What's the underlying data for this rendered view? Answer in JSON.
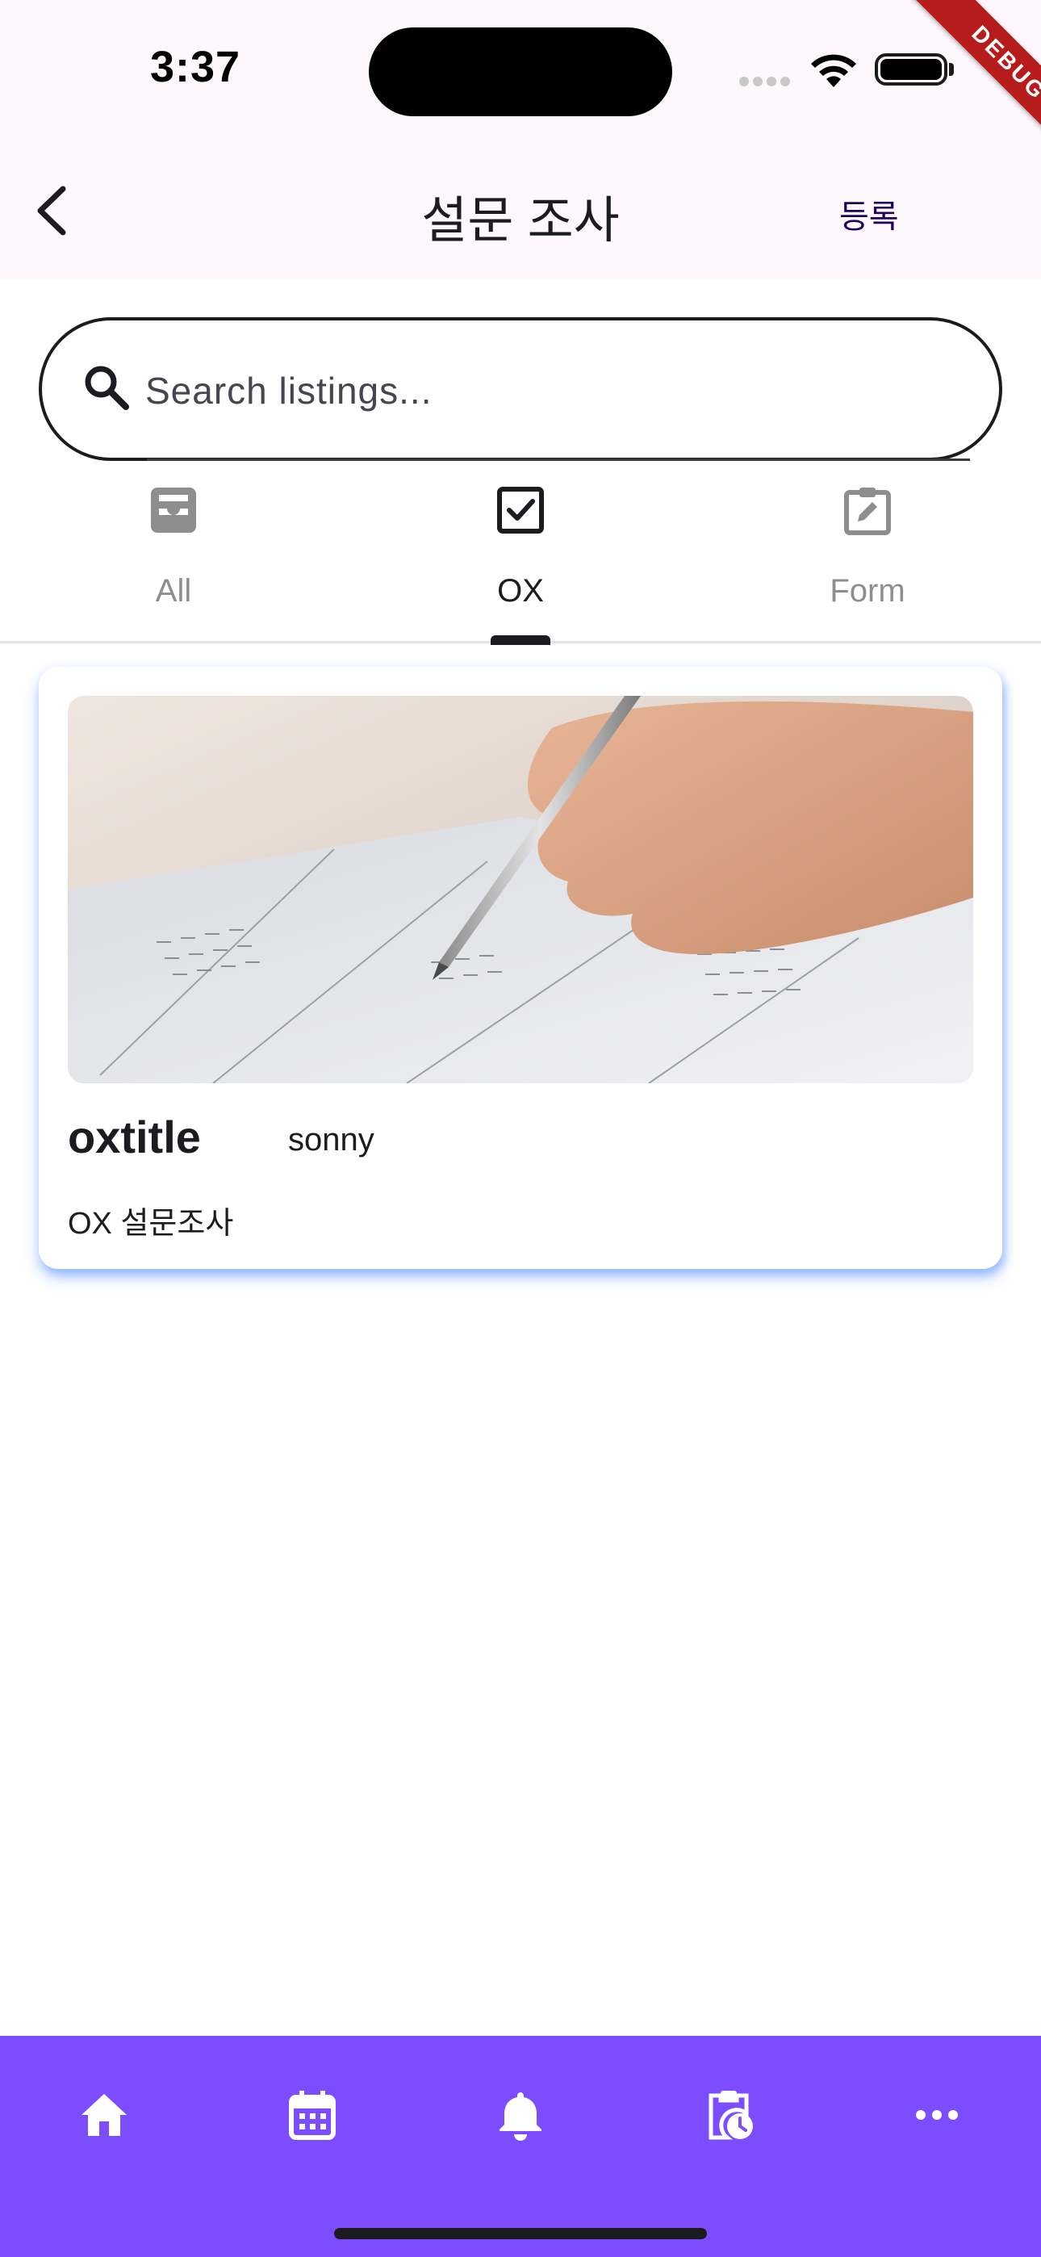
{
  "status_bar": {
    "time": "3:37",
    "debug_label": "DEBUG"
  },
  "app_bar": {
    "title": "설문 조사",
    "action_label": "등록",
    "back_icon": "chevron-left-icon"
  },
  "search": {
    "placeholder": "Search listings...",
    "value": ""
  },
  "tabs": [
    {
      "label": "All",
      "icon": "inbox-icon",
      "selected": false
    },
    {
      "label": "OX",
      "icon": "checkbox-icon",
      "selected": true
    },
    {
      "label": "Form",
      "icon": "edit-form-icon",
      "selected": false
    }
  ],
  "cards": [
    {
      "title": "oxtitle",
      "author": "sonny",
      "description": "OX 설문조사",
      "image": "survey-writing-photo"
    }
  ],
  "bottom_nav": [
    {
      "icon": "home-icon"
    },
    {
      "icon": "calendar-icon"
    },
    {
      "icon": "bell-icon"
    },
    {
      "icon": "clipboard-clock-icon"
    },
    {
      "icon": "more-icon"
    }
  ],
  "colors": {
    "accent": "#7c4dff",
    "app_bar_bg": "#fef7fb",
    "action_text": "#21005d",
    "debug_ribbon": "#b71c1c"
  }
}
